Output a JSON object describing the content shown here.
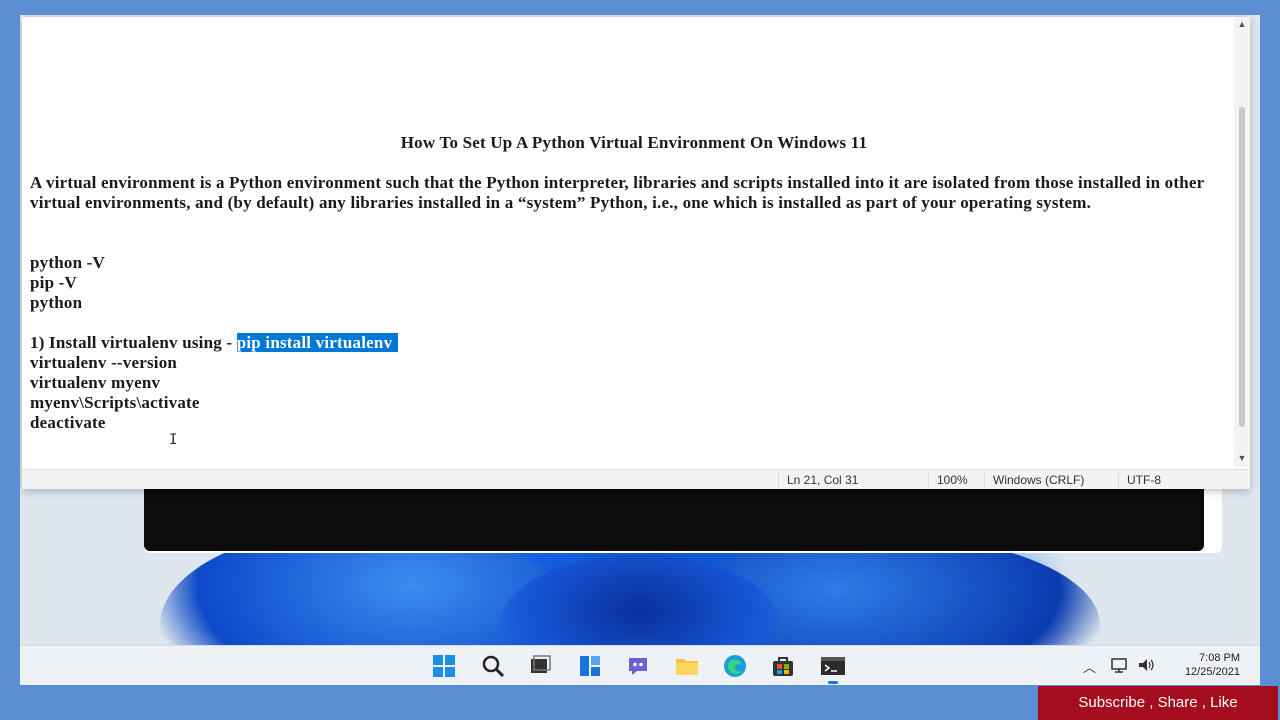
{
  "document": {
    "title": "How To Set Up A Python Virtual Environment On Windows 11",
    "paragraph": "A virtual environment is a Python environment such that the Python interpreter, libraries and scripts installed into it are isolated from those installed in other virtual environments, and (by default) any libraries installed in a “system” Python, i.e., one which is installed as part of your operating system.",
    "commands_a": [
      "python -V",
      "pip -V",
      "python"
    ],
    "step1_prefix": "1) Install virtualenv using - ",
    "step1_selected": "pip install virtualenv",
    "commands_b": [
      "virtualenv --version",
      "virtualenv myenv",
      "myenv\\Scripts\\activate",
      "deactivate"
    ]
  },
  "statusbar": {
    "position": "Ln 21, Col 31",
    "zoom": "100%",
    "line_ending": "Windows (CRLF)",
    "encoding": "UTF-8"
  },
  "taskbar": {
    "icons": [
      "windows-start-icon",
      "search-icon",
      "task-view-icon",
      "widgets-icon",
      "teams-chat-icon",
      "file-explorer-icon",
      "edge-icon",
      "store-icon",
      "terminal-icon"
    ],
    "time": "7:08 PM",
    "date": "12/25/2021"
  },
  "banner": {
    "text": "Subscribe , Share ,  Like"
  },
  "colors": {
    "selection": "#0078d7",
    "banner": "#a40d1e",
    "background": "#5b8fd3"
  }
}
